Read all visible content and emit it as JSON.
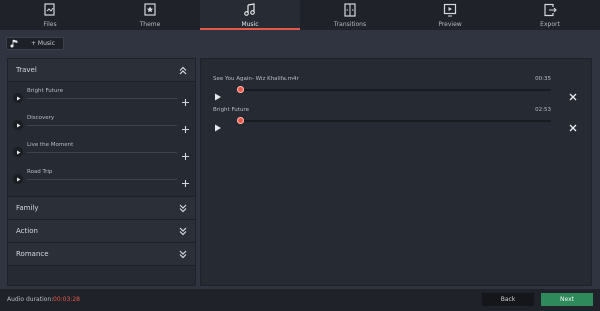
{
  "tabs": [
    {
      "label": "Files",
      "icon": "files-icon"
    },
    {
      "label": "Theme",
      "icon": "theme-icon"
    },
    {
      "label": "Music",
      "icon": "music-icon",
      "active": true
    },
    {
      "label": "Transitions",
      "icon": "transitions-icon"
    },
    {
      "label": "Preview",
      "icon": "preview-icon"
    },
    {
      "label": "Export",
      "icon": "export-icon"
    }
  ],
  "add_music": {
    "label": "+ Music"
  },
  "library": {
    "travel": {
      "title": "Travel",
      "tracks": [
        "Bright Future",
        "Discovery",
        "Live the Moment",
        "Road Trip"
      ]
    },
    "family": {
      "title": "Family"
    },
    "action": {
      "title": "Action"
    },
    "romance": {
      "title": "Romance"
    }
  },
  "timeline": {
    "clips": [
      {
        "name": "See You Again- Wiz Khalifa.m4r",
        "duration": "00:35",
        "progress": 0
      },
      {
        "name": "Bright Future",
        "duration": "02:53",
        "progress": 0
      }
    ]
  },
  "footer": {
    "duration_label": "Audio duration:",
    "duration_value": "00:03:28",
    "back_label": "Back",
    "next_label": "Next"
  },
  "colors": {
    "accent": "#e8584a",
    "next": "#2e8a5b",
    "background": "#2f3440"
  }
}
